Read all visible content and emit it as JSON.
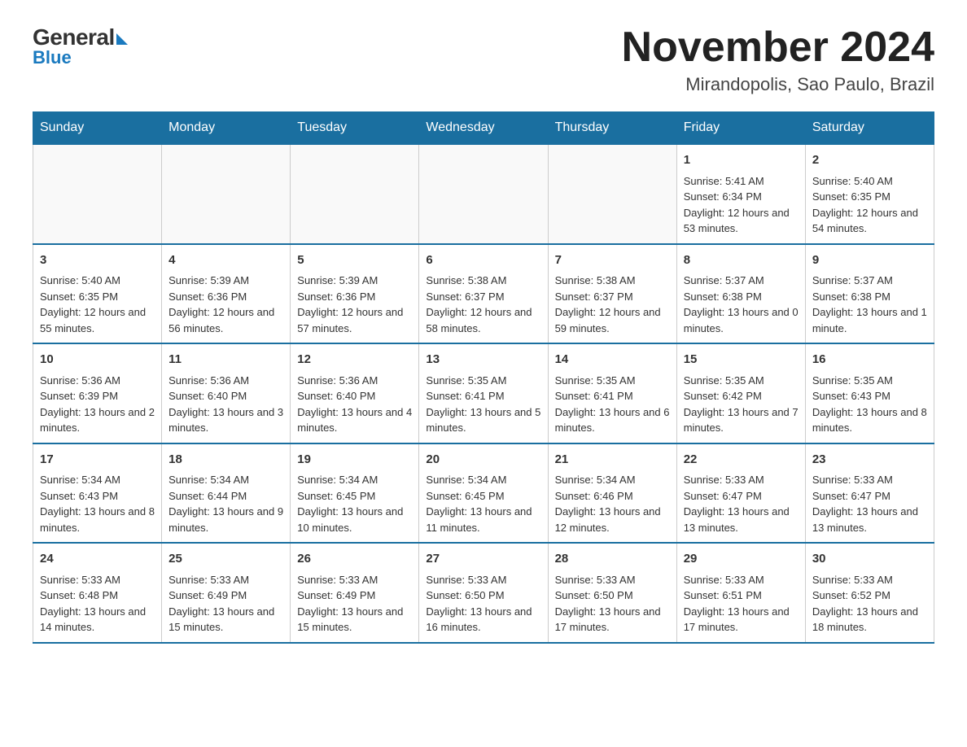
{
  "header": {
    "logo": {
      "general": "General",
      "blue": "Blue"
    },
    "title": "November 2024",
    "subtitle": "Mirandopolis, Sao Paulo, Brazil"
  },
  "weekdays": [
    "Sunday",
    "Monday",
    "Tuesday",
    "Wednesday",
    "Thursday",
    "Friday",
    "Saturday"
  ],
  "weeks": [
    [
      {
        "day": "",
        "info": ""
      },
      {
        "day": "",
        "info": ""
      },
      {
        "day": "",
        "info": ""
      },
      {
        "day": "",
        "info": ""
      },
      {
        "day": "",
        "info": ""
      },
      {
        "day": "1",
        "info": "Sunrise: 5:41 AM\nSunset: 6:34 PM\nDaylight: 12 hours and 53 minutes."
      },
      {
        "day": "2",
        "info": "Sunrise: 5:40 AM\nSunset: 6:35 PM\nDaylight: 12 hours and 54 minutes."
      }
    ],
    [
      {
        "day": "3",
        "info": "Sunrise: 5:40 AM\nSunset: 6:35 PM\nDaylight: 12 hours and 55 minutes."
      },
      {
        "day": "4",
        "info": "Sunrise: 5:39 AM\nSunset: 6:36 PM\nDaylight: 12 hours and 56 minutes."
      },
      {
        "day": "5",
        "info": "Sunrise: 5:39 AM\nSunset: 6:36 PM\nDaylight: 12 hours and 57 minutes."
      },
      {
        "day": "6",
        "info": "Sunrise: 5:38 AM\nSunset: 6:37 PM\nDaylight: 12 hours and 58 minutes."
      },
      {
        "day": "7",
        "info": "Sunrise: 5:38 AM\nSunset: 6:37 PM\nDaylight: 12 hours and 59 minutes."
      },
      {
        "day": "8",
        "info": "Sunrise: 5:37 AM\nSunset: 6:38 PM\nDaylight: 13 hours and 0 minutes."
      },
      {
        "day": "9",
        "info": "Sunrise: 5:37 AM\nSunset: 6:38 PM\nDaylight: 13 hours and 1 minute."
      }
    ],
    [
      {
        "day": "10",
        "info": "Sunrise: 5:36 AM\nSunset: 6:39 PM\nDaylight: 13 hours and 2 minutes."
      },
      {
        "day": "11",
        "info": "Sunrise: 5:36 AM\nSunset: 6:40 PM\nDaylight: 13 hours and 3 minutes."
      },
      {
        "day": "12",
        "info": "Sunrise: 5:36 AM\nSunset: 6:40 PM\nDaylight: 13 hours and 4 minutes."
      },
      {
        "day": "13",
        "info": "Sunrise: 5:35 AM\nSunset: 6:41 PM\nDaylight: 13 hours and 5 minutes."
      },
      {
        "day": "14",
        "info": "Sunrise: 5:35 AM\nSunset: 6:41 PM\nDaylight: 13 hours and 6 minutes."
      },
      {
        "day": "15",
        "info": "Sunrise: 5:35 AM\nSunset: 6:42 PM\nDaylight: 13 hours and 7 minutes."
      },
      {
        "day": "16",
        "info": "Sunrise: 5:35 AM\nSunset: 6:43 PM\nDaylight: 13 hours and 8 minutes."
      }
    ],
    [
      {
        "day": "17",
        "info": "Sunrise: 5:34 AM\nSunset: 6:43 PM\nDaylight: 13 hours and 8 minutes."
      },
      {
        "day": "18",
        "info": "Sunrise: 5:34 AM\nSunset: 6:44 PM\nDaylight: 13 hours and 9 minutes."
      },
      {
        "day": "19",
        "info": "Sunrise: 5:34 AM\nSunset: 6:45 PM\nDaylight: 13 hours and 10 minutes."
      },
      {
        "day": "20",
        "info": "Sunrise: 5:34 AM\nSunset: 6:45 PM\nDaylight: 13 hours and 11 minutes."
      },
      {
        "day": "21",
        "info": "Sunrise: 5:34 AM\nSunset: 6:46 PM\nDaylight: 13 hours and 12 minutes."
      },
      {
        "day": "22",
        "info": "Sunrise: 5:33 AM\nSunset: 6:47 PM\nDaylight: 13 hours and 13 minutes."
      },
      {
        "day": "23",
        "info": "Sunrise: 5:33 AM\nSunset: 6:47 PM\nDaylight: 13 hours and 13 minutes."
      }
    ],
    [
      {
        "day": "24",
        "info": "Sunrise: 5:33 AM\nSunset: 6:48 PM\nDaylight: 13 hours and 14 minutes."
      },
      {
        "day": "25",
        "info": "Sunrise: 5:33 AM\nSunset: 6:49 PM\nDaylight: 13 hours and 15 minutes."
      },
      {
        "day": "26",
        "info": "Sunrise: 5:33 AM\nSunset: 6:49 PM\nDaylight: 13 hours and 15 minutes."
      },
      {
        "day": "27",
        "info": "Sunrise: 5:33 AM\nSunset: 6:50 PM\nDaylight: 13 hours and 16 minutes."
      },
      {
        "day": "28",
        "info": "Sunrise: 5:33 AM\nSunset: 6:50 PM\nDaylight: 13 hours and 17 minutes."
      },
      {
        "day": "29",
        "info": "Sunrise: 5:33 AM\nSunset: 6:51 PM\nDaylight: 13 hours and 17 minutes."
      },
      {
        "day": "30",
        "info": "Sunrise: 5:33 AM\nSunset: 6:52 PM\nDaylight: 13 hours and 18 minutes."
      }
    ]
  ]
}
